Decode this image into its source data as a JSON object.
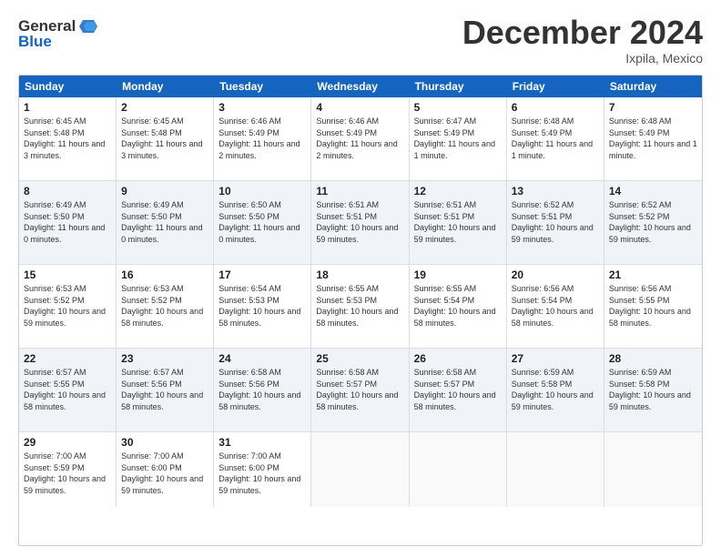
{
  "header": {
    "logo_text1": "General",
    "logo_text2": "Blue",
    "title": "December 2024",
    "location": "Ixpila, Mexico"
  },
  "calendar": {
    "days": [
      "Sunday",
      "Monday",
      "Tuesday",
      "Wednesday",
      "Thursday",
      "Friday",
      "Saturday"
    ],
    "rows": [
      [
        {
          "day": "1",
          "sunrise": "6:45 AM",
          "sunset": "5:48 PM",
          "daylight": "11 hours and 3 minutes."
        },
        {
          "day": "2",
          "sunrise": "6:45 AM",
          "sunset": "5:48 PM",
          "daylight": "11 hours and 3 minutes."
        },
        {
          "day": "3",
          "sunrise": "6:46 AM",
          "sunset": "5:49 PM",
          "daylight": "11 hours and 2 minutes."
        },
        {
          "day": "4",
          "sunrise": "6:46 AM",
          "sunset": "5:49 PM",
          "daylight": "11 hours and 2 minutes."
        },
        {
          "day": "5",
          "sunrise": "6:47 AM",
          "sunset": "5:49 PM",
          "daylight": "11 hours and 1 minute."
        },
        {
          "day": "6",
          "sunrise": "6:48 AM",
          "sunset": "5:49 PM",
          "daylight": "11 hours and 1 minute."
        },
        {
          "day": "7",
          "sunrise": "6:48 AM",
          "sunset": "5:49 PM",
          "daylight": "11 hours and 1 minute."
        }
      ],
      [
        {
          "day": "8",
          "sunrise": "6:49 AM",
          "sunset": "5:50 PM",
          "daylight": "11 hours and 0 minutes."
        },
        {
          "day": "9",
          "sunrise": "6:49 AM",
          "sunset": "5:50 PM",
          "daylight": "11 hours and 0 minutes."
        },
        {
          "day": "10",
          "sunrise": "6:50 AM",
          "sunset": "5:50 PM",
          "daylight": "11 hours and 0 minutes."
        },
        {
          "day": "11",
          "sunrise": "6:51 AM",
          "sunset": "5:51 PM",
          "daylight": "10 hours and 59 minutes."
        },
        {
          "day": "12",
          "sunrise": "6:51 AM",
          "sunset": "5:51 PM",
          "daylight": "10 hours and 59 minutes."
        },
        {
          "day": "13",
          "sunrise": "6:52 AM",
          "sunset": "5:51 PM",
          "daylight": "10 hours and 59 minutes."
        },
        {
          "day": "14",
          "sunrise": "6:52 AM",
          "sunset": "5:52 PM",
          "daylight": "10 hours and 59 minutes."
        }
      ],
      [
        {
          "day": "15",
          "sunrise": "6:53 AM",
          "sunset": "5:52 PM",
          "daylight": "10 hours and 59 minutes."
        },
        {
          "day": "16",
          "sunrise": "6:53 AM",
          "sunset": "5:52 PM",
          "daylight": "10 hours and 58 minutes."
        },
        {
          "day": "17",
          "sunrise": "6:54 AM",
          "sunset": "5:53 PM",
          "daylight": "10 hours and 58 minutes."
        },
        {
          "day": "18",
          "sunrise": "6:55 AM",
          "sunset": "5:53 PM",
          "daylight": "10 hours and 58 minutes."
        },
        {
          "day": "19",
          "sunrise": "6:55 AM",
          "sunset": "5:54 PM",
          "daylight": "10 hours and 58 minutes."
        },
        {
          "day": "20",
          "sunrise": "6:56 AM",
          "sunset": "5:54 PM",
          "daylight": "10 hours and 58 minutes."
        },
        {
          "day": "21",
          "sunrise": "6:56 AM",
          "sunset": "5:55 PM",
          "daylight": "10 hours and 58 minutes."
        }
      ],
      [
        {
          "day": "22",
          "sunrise": "6:57 AM",
          "sunset": "5:55 PM",
          "daylight": "10 hours and 58 minutes."
        },
        {
          "day": "23",
          "sunrise": "6:57 AM",
          "sunset": "5:56 PM",
          "daylight": "10 hours and 58 minutes."
        },
        {
          "day": "24",
          "sunrise": "6:58 AM",
          "sunset": "5:56 PM",
          "daylight": "10 hours and 58 minutes."
        },
        {
          "day": "25",
          "sunrise": "6:58 AM",
          "sunset": "5:57 PM",
          "daylight": "10 hours and 58 minutes."
        },
        {
          "day": "26",
          "sunrise": "6:58 AM",
          "sunset": "5:57 PM",
          "daylight": "10 hours and 58 minutes."
        },
        {
          "day": "27",
          "sunrise": "6:59 AM",
          "sunset": "5:58 PM",
          "daylight": "10 hours and 59 minutes."
        },
        {
          "day": "28",
          "sunrise": "6:59 AM",
          "sunset": "5:58 PM",
          "daylight": "10 hours and 59 minutes."
        }
      ],
      [
        {
          "day": "29",
          "sunrise": "7:00 AM",
          "sunset": "5:59 PM",
          "daylight": "10 hours and 59 minutes."
        },
        {
          "day": "30",
          "sunrise": "7:00 AM",
          "sunset": "6:00 PM",
          "daylight": "10 hours and 59 minutes."
        },
        {
          "day": "31",
          "sunrise": "7:00 AM",
          "sunset": "6:00 PM",
          "daylight": "10 hours and 59 minutes."
        },
        null,
        null,
        null,
        null
      ]
    ]
  }
}
